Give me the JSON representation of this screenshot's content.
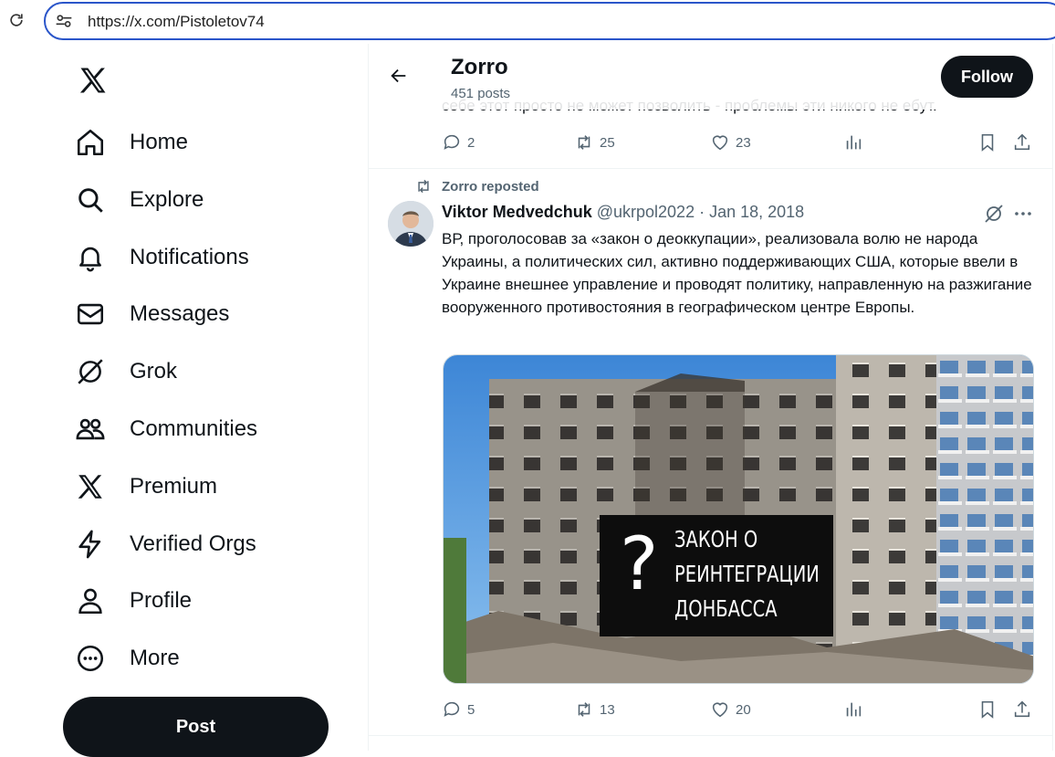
{
  "browser": {
    "url": "https://x.com/Pistoletov74"
  },
  "sidebar": {
    "items": [
      {
        "label": "Home",
        "icon": "home-icon"
      },
      {
        "label": "Explore",
        "icon": "search-icon"
      },
      {
        "label": "Notifications",
        "icon": "bell-icon"
      },
      {
        "label": "Messages",
        "icon": "envelope-icon"
      },
      {
        "label": "Grok",
        "icon": "grok-icon"
      },
      {
        "label": "Communities",
        "icon": "people-icon"
      },
      {
        "label": "Premium",
        "icon": "x-logo-icon"
      },
      {
        "label": "Verified Orgs",
        "icon": "lightning-icon"
      },
      {
        "label": "Profile",
        "icon": "person-icon"
      },
      {
        "label": "More",
        "icon": "more-circle-icon"
      }
    ],
    "post_label": "Post"
  },
  "header": {
    "name": "Zorro",
    "posts": "451 posts",
    "follow_label": "Follow"
  },
  "prev_tweet": {
    "cut_text": "себе этот просто не может позволить - проблемы эти никого не ебут.",
    "replies": "2",
    "reposts": "25",
    "likes": "23"
  },
  "tweet": {
    "repost_label": "Zorro reposted",
    "author_name": "Viktor Medvedchuk",
    "author_handle": "@ukrpol2022",
    "date": " · Jan 18, 2018",
    "text": "ВР, проголосовав за «закон о деоккупации», реализовала волю не народа Украины, а политических сил, активно поддерживающих США, которые ввели в Украине внешнее управление и проводят политику, направленную на разжигание вооруженного противостояния в географическом центре Европы.",
    "media_line1": "ЗАКОН О",
    "media_line2": "РЕИНТЕГРАЦИИ",
    "media_line3": "ДОНБАССА",
    "media_mark": "?",
    "replies": "5",
    "reposts": "13",
    "likes": "20"
  },
  "colors": {
    "accent": "#0f1419",
    "muted": "#536471",
    "url_border": "#2a55c9"
  }
}
